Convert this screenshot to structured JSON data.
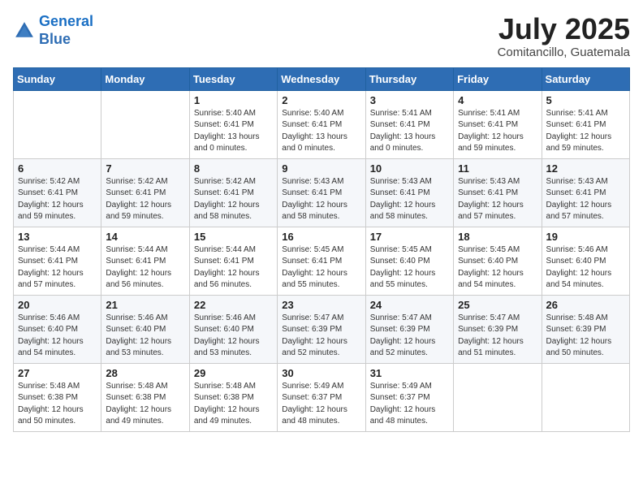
{
  "header": {
    "logo_line1": "General",
    "logo_line2": "Blue",
    "month_title": "July 2025",
    "subtitle": "Comitancillo, Guatemala"
  },
  "weekdays": [
    "Sunday",
    "Monday",
    "Tuesday",
    "Wednesday",
    "Thursday",
    "Friday",
    "Saturday"
  ],
  "weeks": [
    [
      {
        "day": "",
        "sunrise": "",
        "sunset": "",
        "daylight": ""
      },
      {
        "day": "",
        "sunrise": "",
        "sunset": "",
        "daylight": ""
      },
      {
        "day": "1",
        "sunrise": "Sunrise: 5:40 AM",
        "sunset": "Sunset: 6:41 PM",
        "daylight": "Daylight: 13 hours and 0 minutes."
      },
      {
        "day": "2",
        "sunrise": "Sunrise: 5:40 AM",
        "sunset": "Sunset: 6:41 PM",
        "daylight": "Daylight: 13 hours and 0 minutes."
      },
      {
        "day": "3",
        "sunrise": "Sunrise: 5:41 AM",
        "sunset": "Sunset: 6:41 PM",
        "daylight": "Daylight: 13 hours and 0 minutes."
      },
      {
        "day": "4",
        "sunrise": "Sunrise: 5:41 AM",
        "sunset": "Sunset: 6:41 PM",
        "daylight": "Daylight: 12 hours and 59 minutes."
      },
      {
        "day": "5",
        "sunrise": "Sunrise: 5:41 AM",
        "sunset": "Sunset: 6:41 PM",
        "daylight": "Daylight: 12 hours and 59 minutes."
      }
    ],
    [
      {
        "day": "6",
        "sunrise": "Sunrise: 5:42 AM",
        "sunset": "Sunset: 6:41 PM",
        "daylight": "Daylight: 12 hours and 59 minutes."
      },
      {
        "day": "7",
        "sunrise": "Sunrise: 5:42 AM",
        "sunset": "Sunset: 6:41 PM",
        "daylight": "Daylight: 12 hours and 59 minutes."
      },
      {
        "day": "8",
        "sunrise": "Sunrise: 5:42 AM",
        "sunset": "Sunset: 6:41 PM",
        "daylight": "Daylight: 12 hours and 58 minutes."
      },
      {
        "day": "9",
        "sunrise": "Sunrise: 5:43 AM",
        "sunset": "Sunset: 6:41 PM",
        "daylight": "Daylight: 12 hours and 58 minutes."
      },
      {
        "day": "10",
        "sunrise": "Sunrise: 5:43 AM",
        "sunset": "Sunset: 6:41 PM",
        "daylight": "Daylight: 12 hours and 58 minutes."
      },
      {
        "day": "11",
        "sunrise": "Sunrise: 5:43 AM",
        "sunset": "Sunset: 6:41 PM",
        "daylight": "Daylight: 12 hours and 57 minutes."
      },
      {
        "day": "12",
        "sunrise": "Sunrise: 5:43 AM",
        "sunset": "Sunset: 6:41 PM",
        "daylight": "Daylight: 12 hours and 57 minutes."
      }
    ],
    [
      {
        "day": "13",
        "sunrise": "Sunrise: 5:44 AM",
        "sunset": "Sunset: 6:41 PM",
        "daylight": "Daylight: 12 hours and 57 minutes."
      },
      {
        "day": "14",
        "sunrise": "Sunrise: 5:44 AM",
        "sunset": "Sunset: 6:41 PM",
        "daylight": "Daylight: 12 hours and 56 minutes."
      },
      {
        "day": "15",
        "sunrise": "Sunrise: 5:44 AM",
        "sunset": "Sunset: 6:41 PM",
        "daylight": "Daylight: 12 hours and 56 minutes."
      },
      {
        "day": "16",
        "sunrise": "Sunrise: 5:45 AM",
        "sunset": "Sunset: 6:41 PM",
        "daylight": "Daylight: 12 hours and 55 minutes."
      },
      {
        "day": "17",
        "sunrise": "Sunrise: 5:45 AM",
        "sunset": "Sunset: 6:40 PM",
        "daylight": "Daylight: 12 hours and 55 minutes."
      },
      {
        "day": "18",
        "sunrise": "Sunrise: 5:45 AM",
        "sunset": "Sunset: 6:40 PM",
        "daylight": "Daylight: 12 hours and 54 minutes."
      },
      {
        "day": "19",
        "sunrise": "Sunrise: 5:46 AM",
        "sunset": "Sunset: 6:40 PM",
        "daylight": "Daylight: 12 hours and 54 minutes."
      }
    ],
    [
      {
        "day": "20",
        "sunrise": "Sunrise: 5:46 AM",
        "sunset": "Sunset: 6:40 PM",
        "daylight": "Daylight: 12 hours and 54 minutes."
      },
      {
        "day": "21",
        "sunrise": "Sunrise: 5:46 AM",
        "sunset": "Sunset: 6:40 PM",
        "daylight": "Daylight: 12 hours and 53 minutes."
      },
      {
        "day": "22",
        "sunrise": "Sunrise: 5:46 AM",
        "sunset": "Sunset: 6:40 PM",
        "daylight": "Daylight: 12 hours and 53 minutes."
      },
      {
        "day": "23",
        "sunrise": "Sunrise: 5:47 AM",
        "sunset": "Sunset: 6:39 PM",
        "daylight": "Daylight: 12 hours and 52 minutes."
      },
      {
        "day": "24",
        "sunrise": "Sunrise: 5:47 AM",
        "sunset": "Sunset: 6:39 PM",
        "daylight": "Daylight: 12 hours and 52 minutes."
      },
      {
        "day": "25",
        "sunrise": "Sunrise: 5:47 AM",
        "sunset": "Sunset: 6:39 PM",
        "daylight": "Daylight: 12 hours and 51 minutes."
      },
      {
        "day": "26",
        "sunrise": "Sunrise: 5:48 AM",
        "sunset": "Sunset: 6:39 PM",
        "daylight": "Daylight: 12 hours and 50 minutes."
      }
    ],
    [
      {
        "day": "27",
        "sunrise": "Sunrise: 5:48 AM",
        "sunset": "Sunset: 6:38 PM",
        "daylight": "Daylight: 12 hours and 50 minutes."
      },
      {
        "day": "28",
        "sunrise": "Sunrise: 5:48 AM",
        "sunset": "Sunset: 6:38 PM",
        "daylight": "Daylight: 12 hours and 49 minutes."
      },
      {
        "day": "29",
        "sunrise": "Sunrise: 5:48 AM",
        "sunset": "Sunset: 6:38 PM",
        "daylight": "Daylight: 12 hours and 49 minutes."
      },
      {
        "day": "30",
        "sunrise": "Sunrise: 5:49 AM",
        "sunset": "Sunset: 6:37 PM",
        "daylight": "Daylight: 12 hours and 48 minutes."
      },
      {
        "day": "31",
        "sunrise": "Sunrise: 5:49 AM",
        "sunset": "Sunset: 6:37 PM",
        "daylight": "Daylight: 12 hours and 48 minutes."
      },
      {
        "day": "",
        "sunrise": "",
        "sunset": "",
        "daylight": ""
      },
      {
        "day": "",
        "sunrise": "",
        "sunset": "",
        "daylight": ""
      }
    ]
  ]
}
